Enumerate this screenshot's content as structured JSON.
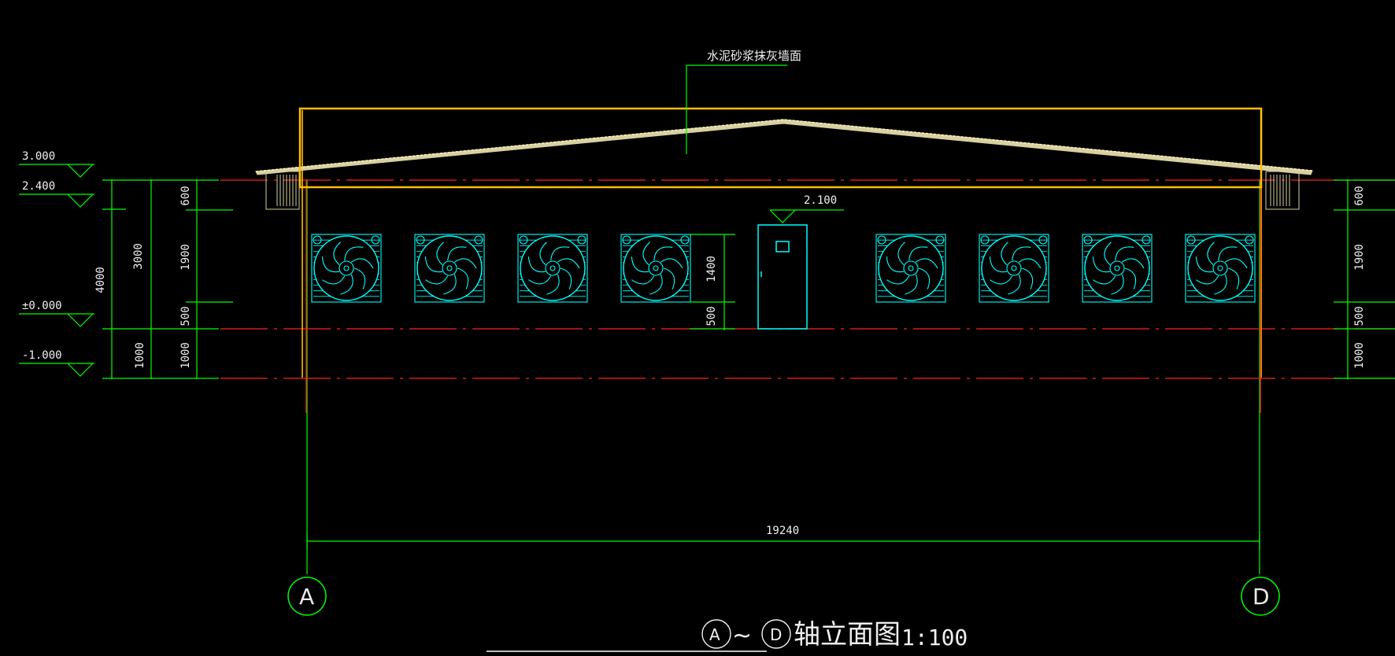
{
  "colors": {
    "background": "#000000",
    "green": "#00ff00",
    "red": "#ff2020",
    "yellow": "#ffc000",
    "cyan": "#00ffff",
    "white": "#f0f0f0",
    "roof": "#d8d0a0"
  },
  "annotation": {
    "wall_finish": "水泥砂浆抹灰墙面"
  },
  "levels": [
    {
      "label": "3.000"
    },
    {
      "label": "2.400"
    },
    {
      "label": "±0.000"
    },
    {
      "label": "-1.000"
    }
  ],
  "door_level": "2.100",
  "dims_left_outer": [
    "4000",
    "1000"
  ],
  "dims_left_mid": [
    "3000",
    "1000"
  ],
  "dims_left_inner": [
    "600",
    "1900",
    "500",
    "1000"
  ],
  "dims_right": [
    "600",
    "1900",
    "500",
    "1000"
  ],
  "dims_fan": [
    "1400",
    "500"
  ],
  "overall_width": "19240",
  "axes": {
    "left": "A",
    "right": "D"
  },
  "title": {
    "axis_from": "A",
    "tilde": "~",
    "axis_to": "D",
    "text": "轴立面图",
    "scale": "1:100"
  },
  "fans": {
    "count": 8,
    "icon": "exhaust-fan-icon"
  },
  "door": {
    "icon": "door-icon"
  }
}
